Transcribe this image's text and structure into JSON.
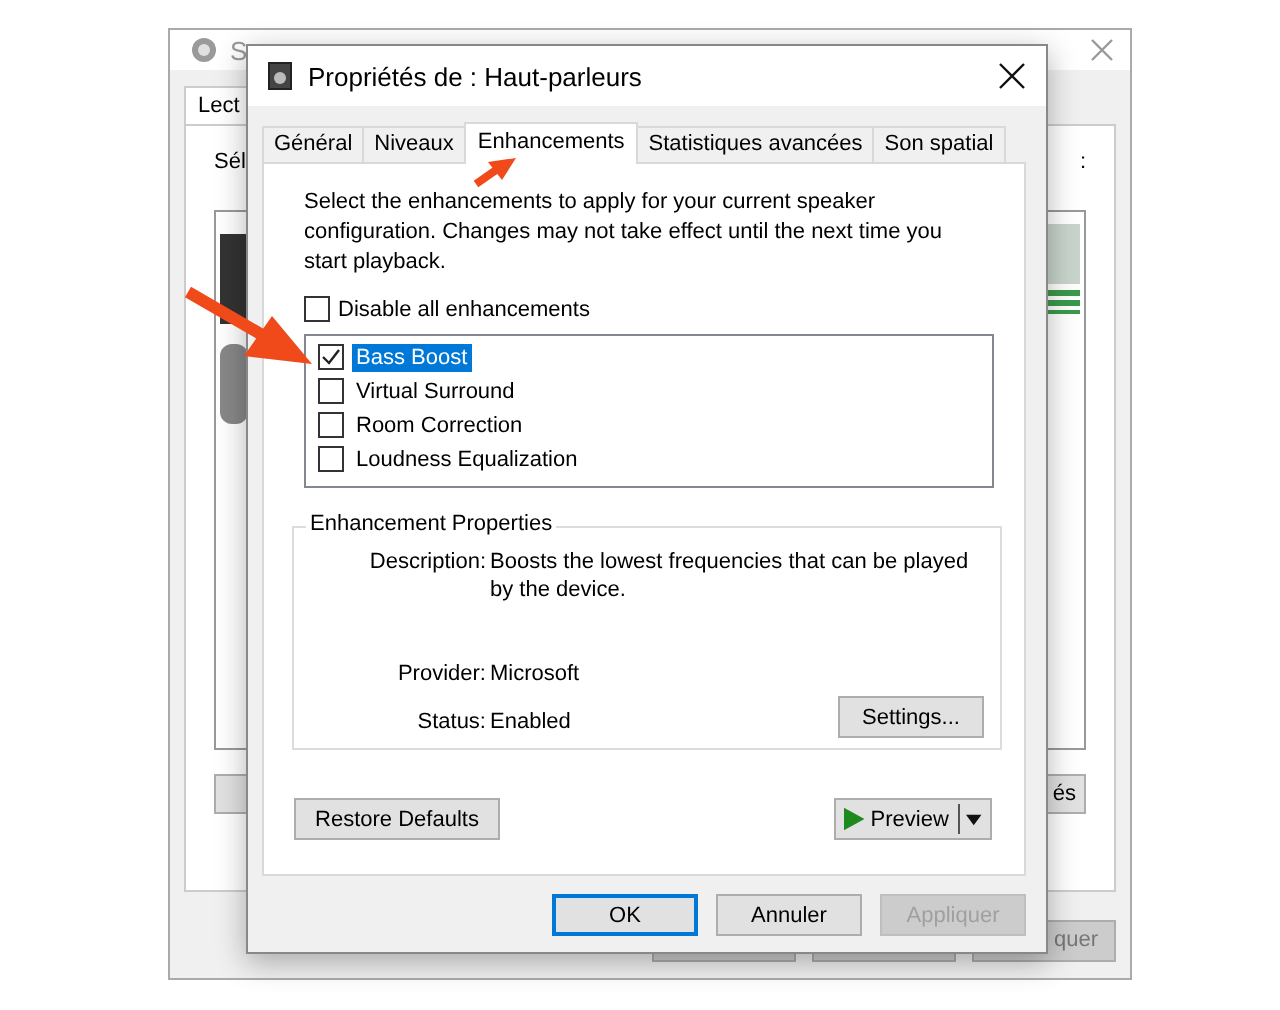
{
  "background_window": {
    "title": "S",
    "tab": "Lect",
    "label": "Sél",
    "label_end": ":",
    "side_button": "és",
    "bottom_button": "quer"
  },
  "dialog": {
    "title": "Propriétés de : Haut-parleurs",
    "tabs": [
      {
        "label": "Général",
        "selected": false
      },
      {
        "label": "Niveaux",
        "selected": false
      },
      {
        "label": "Enhancements",
        "selected": true
      },
      {
        "label": "Statistiques avancées",
        "selected": false
      },
      {
        "label": "Son spatial",
        "selected": false
      }
    ],
    "intro": "Select the enhancements to apply for your current speaker configuration. Changes may not take effect until the next time you start playback.",
    "disable_all": {
      "label": "Disable all enhancements",
      "checked": false
    },
    "enhancements": [
      {
        "label": "Bass Boost",
        "checked": true,
        "selected": true
      },
      {
        "label": "Virtual Surround",
        "checked": false,
        "selected": false
      },
      {
        "label": "Room Correction",
        "checked": false,
        "selected": false
      },
      {
        "label": "Loudness Equalization",
        "checked": false,
        "selected": false
      }
    ],
    "properties": {
      "legend": "Enhancement Properties",
      "fields": [
        {
          "label": "Description:",
          "value": "Boosts the lowest frequencies that can be played by the device."
        },
        {
          "label": "Provider:",
          "value": "Microsoft"
        },
        {
          "label": "Status:",
          "value": "Enabled"
        }
      ],
      "settings_button": "Settings..."
    },
    "restore_button": "Restore Defaults",
    "preview_button": "Preview",
    "buttons": [
      {
        "label": "OK",
        "default": true,
        "disabled": false
      },
      {
        "label": "Annuler",
        "default": false,
        "disabled": false
      },
      {
        "label": "Appliquer",
        "default": false,
        "disabled": true
      }
    ]
  }
}
